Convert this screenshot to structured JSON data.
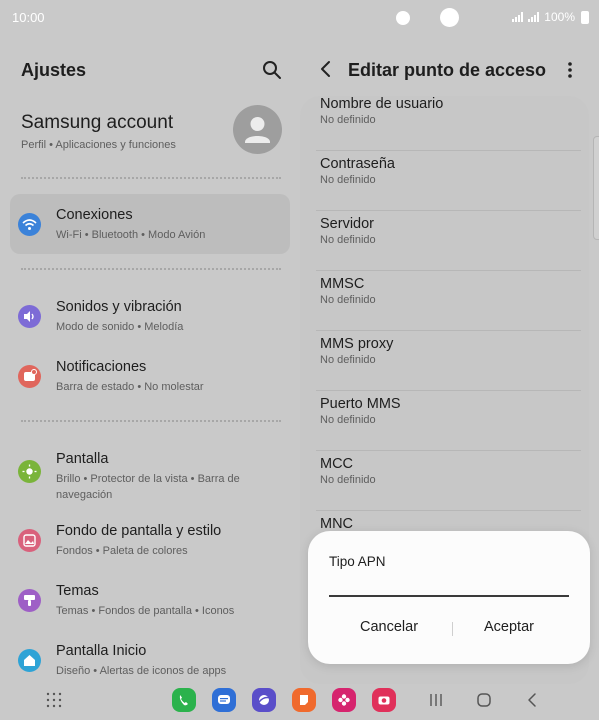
{
  "status": {
    "time": "10:00",
    "battery": "100%"
  },
  "settings": {
    "title": "Ajustes",
    "account": {
      "name": "Samsung account",
      "sub": "Perfil • Aplicaciones y funciones"
    },
    "items": [
      {
        "title": "Conexiones",
        "sub": "Wi-Fi • Bluetooth • Modo Avión",
        "icon": "wifi-icon",
        "color": "#3b82d9",
        "selected": true
      },
      {
        "title": "Sonidos y vibración",
        "sub": "Modo de sonido • Melodía",
        "icon": "speaker-icon",
        "color": "#7d6bd6"
      },
      {
        "title": "Notificaciones",
        "sub": "Barra de estado • No molestar",
        "icon": "bell-icon",
        "color": "#e0665c"
      },
      {
        "title": "Pantalla",
        "sub": "Brillo • Protector de la vista • Barra de navegación",
        "icon": "brightness-icon",
        "color": "#7ab43a"
      },
      {
        "title": "Fondo de pantalla y estilo",
        "sub": "Fondos • Paleta de colores",
        "icon": "wallpaper-icon",
        "color": "#d9617c"
      },
      {
        "title": "Temas",
        "sub": "Temas • Fondos de pantalla • Iconos",
        "icon": "themes-icon",
        "color": "#9e5fc6"
      },
      {
        "title": "Pantalla Inicio",
        "sub": "Diseño • Alertas de iconos de apps",
        "icon": "home-icon",
        "color": "#2ea3d6"
      }
    ]
  },
  "apn": {
    "title": "Editar punto de acceso",
    "fields": [
      {
        "label": "Nombre de usuario",
        "value": "No definido"
      },
      {
        "label": "Contraseña",
        "value": "No definido"
      },
      {
        "label": "Servidor",
        "value": "No definido"
      },
      {
        "label": "MMSC",
        "value": "No definido"
      },
      {
        "label": "MMS proxy",
        "value": "No definido"
      },
      {
        "label": "Puerto MMS",
        "value": "No definido"
      },
      {
        "label": "MCC",
        "value": "No definido"
      },
      {
        "label": "MNC",
        "value": ""
      }
    ]
  },
  "dialog": {
    "title": "Tipo APN",
    "input_value": "",
    "cancel": "Cancelar",
    "accept": "Aceptar"
  },
  "dock": {
    "apps": [
      {
        "name": "phone-icon",
        "color": "#2bb24c"
      },
      {
        "name": "messages-icon",
        "color": "#2f6fd6"
      },
      {
        "name": "internet-icon",
        "color": "#5a4ec9"
      },
      {
        "name": "notes-icon",
        "color": "#f06a2d"
      },
      {
        "name": "gallery-icon",
        "color": "#d6246e"
      },
      {
        "name": "camera-icon",
        "color": "#e0305a"
      }
    ]
  }
}
